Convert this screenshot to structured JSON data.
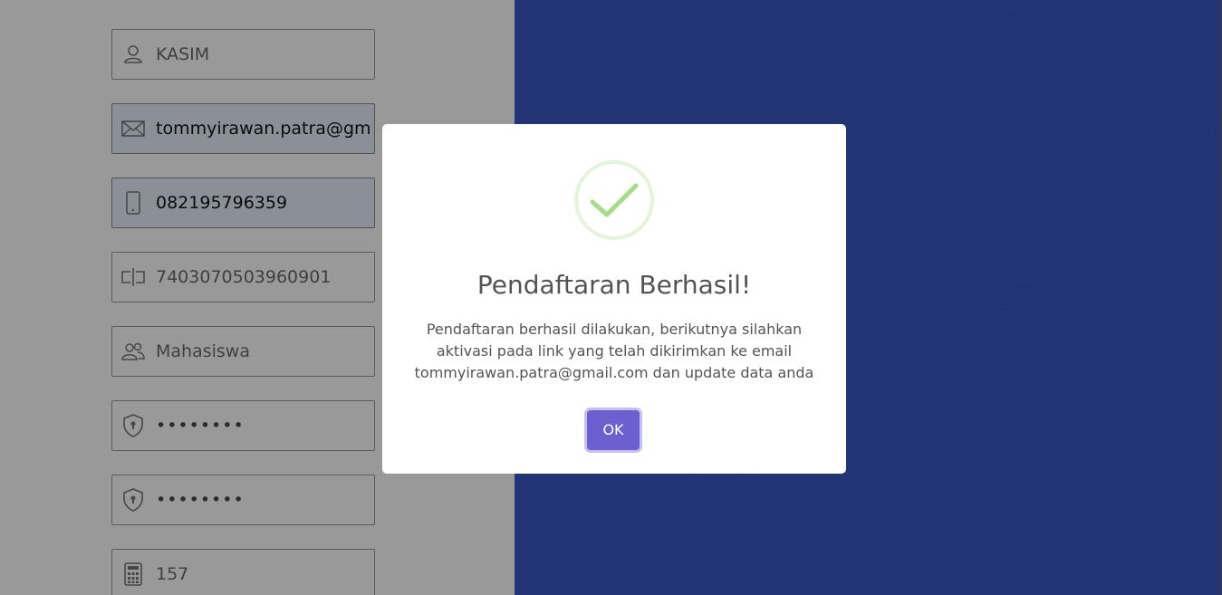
{
  "form": {
    "fields": [
      {
        "name": "name-field",
        "icon": "user-icon",
        "value": "KASIM",
        "autofill": false
      },
      {
        "name": "email-field",
        "icon": "envelope-icon",
        "value": "tommyirawan.patra@gmail.com",
        "autofill": true
      },
      {
        "name": "phone-field",
        "icon": "smartphone-icon",
        "value": "082195796359",
        "autofill": true
      },
      {
        "name": "id-number-field",
        "icon": "text-cursor-icon",
        "value": "7403070503960901",
        "autofill": false
      },
      {
        "name": "role-field",
        "icon": "users-icon",
        "value": "Mahasiswa",
        "autofill": false
      },
      {
        "name": "password-field",
        "icon": "shield-lock-icon",
        "value": "••••••••",
        "autofill": false
      },
      {
        "name": "confirm-password-field",
        "icon": "shield-lock-icon",
        "value": "••••••••",
        "autofill": false
      },
      {
        "name": "captcha-field",
        "icon": "calculator-icon",
        "value": "157",
        "autofill": false
      }
    ]
  },
  "modal": {
    "icon": "success-check-icon",
    "title": "Pendaftaran Berhasil!",
    "message": "Pendaftaran berhasil dilakukan, berikutnya silahkan aktivasi pada link yang telah dikirimkan ke email tommyirawan.patra@gmail.com dan update data anda",
    "ok_label": "OK"
  },
  "colors": {
    "brand_blue": "#3a57c3",
    "ok_button": "#6c5fcf",
    "success_green": "#a5dc86"
  }
}
